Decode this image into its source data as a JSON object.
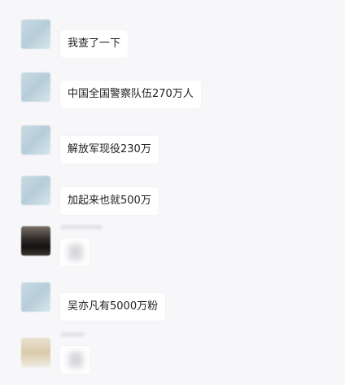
{
  "messages": [
    {
      "text": "我查了一下"
    },
    {
      "text": "中国全国警察队伍270万人"
    },
    {
      "text": "解放军现役230万"
    },
    {
      "text": "加起来也就500万"
    },
    {
      "text": ""
    },
    {
      "text": "吴亦凡有5000万粉"
    },
    {
      "text": ""
    }
  ]
}
